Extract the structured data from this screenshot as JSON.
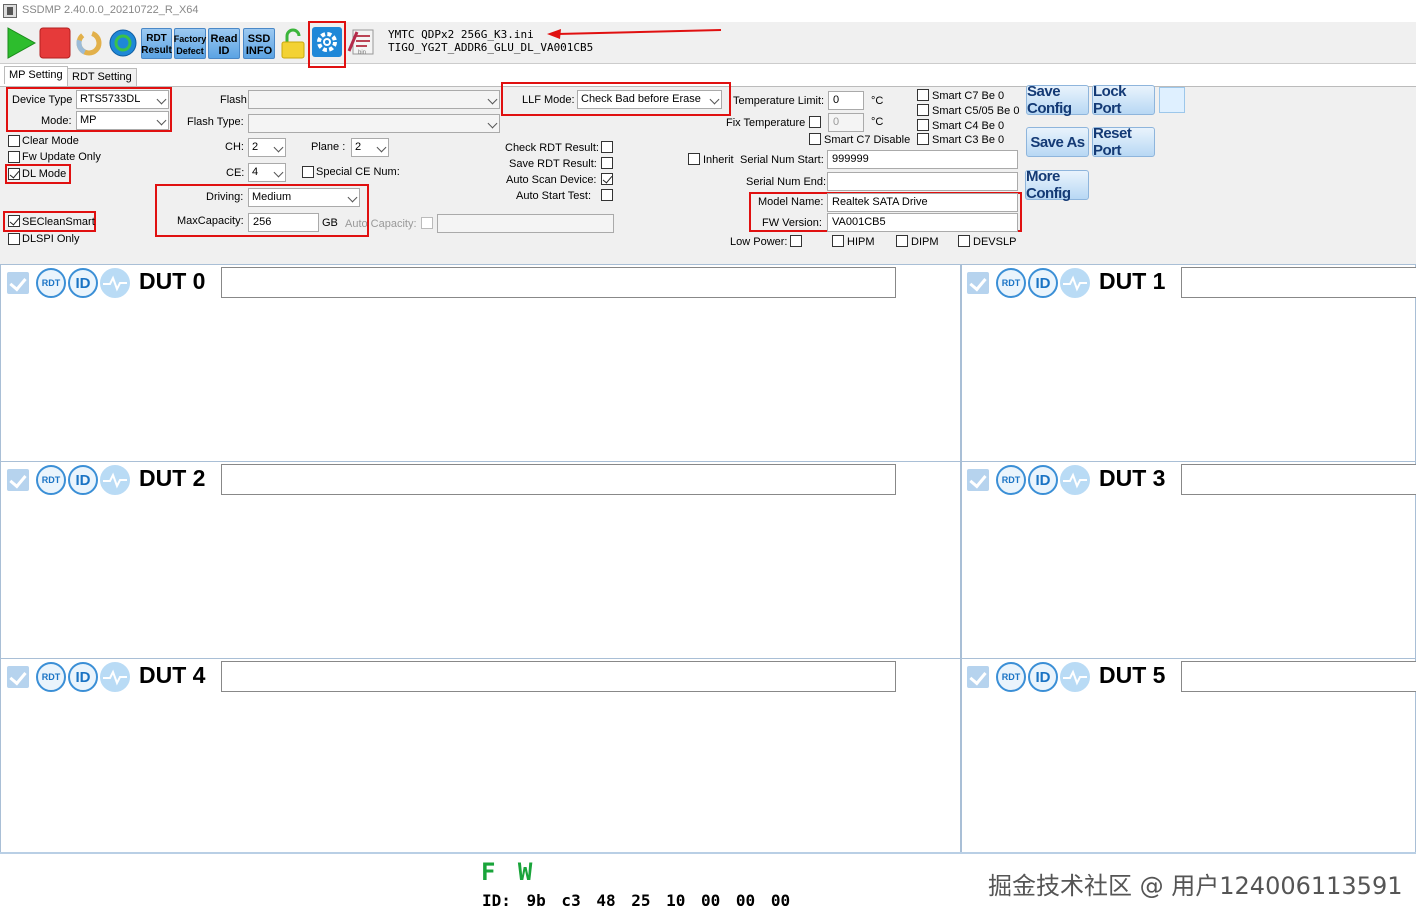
{
  "window": {
    "title": "SSDMP 2.40.0.0_20210722_R_X64"
  },
  "toolbar": {
    "rdt_result_1": "RDT",
    "rdt_result_2": "Result",
    "factory_defect_1": "Factory",
    "factory_defect_2": "Defect",
    "read_id_1": "Read",
    "read_id_2": "ID",
    "ssd_info_1": "SSD",
    "ssd_info_2": "INFO",
    "bin_label": "bin"
  },
  "ini": {
    "file": "YMTC QDPx2 256G_K3.ini",
    "firmware": "TIGO_YG2T_ADDR6_GLU_DL_VA001CB5"
  },
  "tabs": {
    "mp_setting": "MP Setting",
    "rdt_setting": "RDT Setting"
  },
  "settings": {
    "device_type_label": "Device Type",
    "device_type_value": "RTS5733DL",
    "mode_label": "Mode:",
    "mode_value": "MP",
    "clear_mode": "Clear Mode",
    "fw_update_only": "Fw Update Only",
    "dl_mode": "DL Mode",
    "secleansmart": "SECleanSmart",
    "dlspi_only": "DLSPI Only",
    "flash_label": "Flash",
    "flash_value": "",
    "flash_type_label": "Flash Type:",
    "flash_type_value": "",
    "ch_label": "CH:",
    "ch_value": "2",
    "plane_label": "Plane :",
    "plane_value": "2",
    "ce_label": "CE:",
    "ce_value": "4",
    "special_ce": "Special CE Num:",
    "driving_label": "Driving:",
    "driving_value": "Medium",
    "maxcap_label": "MaxCapacity:",
    "maxcap_value": "256",
    "maxcap_unit": "GB",
    "auto_capacity_label": "Auto Capacity:",
    "llf_label": "LLF Mode:",
    "llf_value": "Check Bad before Erase",
    "check_rdt": "Check RDT Result:",
    "save_rdt": "Save RDT Result:",
    "auto_scan": "Auto Scan Device:",
    "auto_start": "Auto Start Test:",
    "temp_limit_label": "Temperature Limit:",
    "temp_limit_value": "0",
    "temp_unit": "°C",
    "fix_temp_label": "Fix Temperature",
    "fix_temp_value": "0",
    "smart_c7_disable": "Smart C7 Disable",
    "inherit_serial": "Inherit",
    "serial_start_label": "Serial Num Start:",
    "serial_start_value": "999999",
    "serial_end_label": "Serial Num End:",
    "serial_end_value": "",
    "model_name_label": "Model Name:",
    "model_name_value": "Realtek SATA Drive",
    "fw_version_label": "FW Version:",
    "fw_version_value": "VA001CB5",
    "low_power": "Low Power:",
    "hipm": "HIPM",
    "dipm": "DIPM",
    "devslp": "DEVSLP",
    "smart_c7_be0": "Smart C7 Be 0",
    "smart_c5_be0": "Smart C5/05 Be 0",
    "smart_c4_be0": "Smart C4 Be 0",
    "smart_c3_be0": "Smart C3 Be 0"
  },
  "buttons": {
    "save_config": "Save Config",
    "lock_port": "Lock Port",
    "save_as": "Save As",
    "reset_port": "Reset Port",
    "more_config": "More Config"
  },
  "duts": {
    "rdt": "RDT",
    "id": "ID",
    "d0": "DUT 0",
    "d1": "DUT 1",
    "d2": "DUT 2",
    "d3": "DUT 3",
    "d4": "DUT 4",
    "d5": "DUT 5"
  },
  "bottom": {
    "fw": "F W",
    "id_line": "ID: 9b c3 48 25 10 00 00 00",
    "watermark": "掘金技术社区 @ 用户124006113591"
  },
  "colors": {
    "annotation_red": "#e01010",
    "fw_green": "#19a43a",
    "accent_blue": "#3b8fd6"
  }
}
